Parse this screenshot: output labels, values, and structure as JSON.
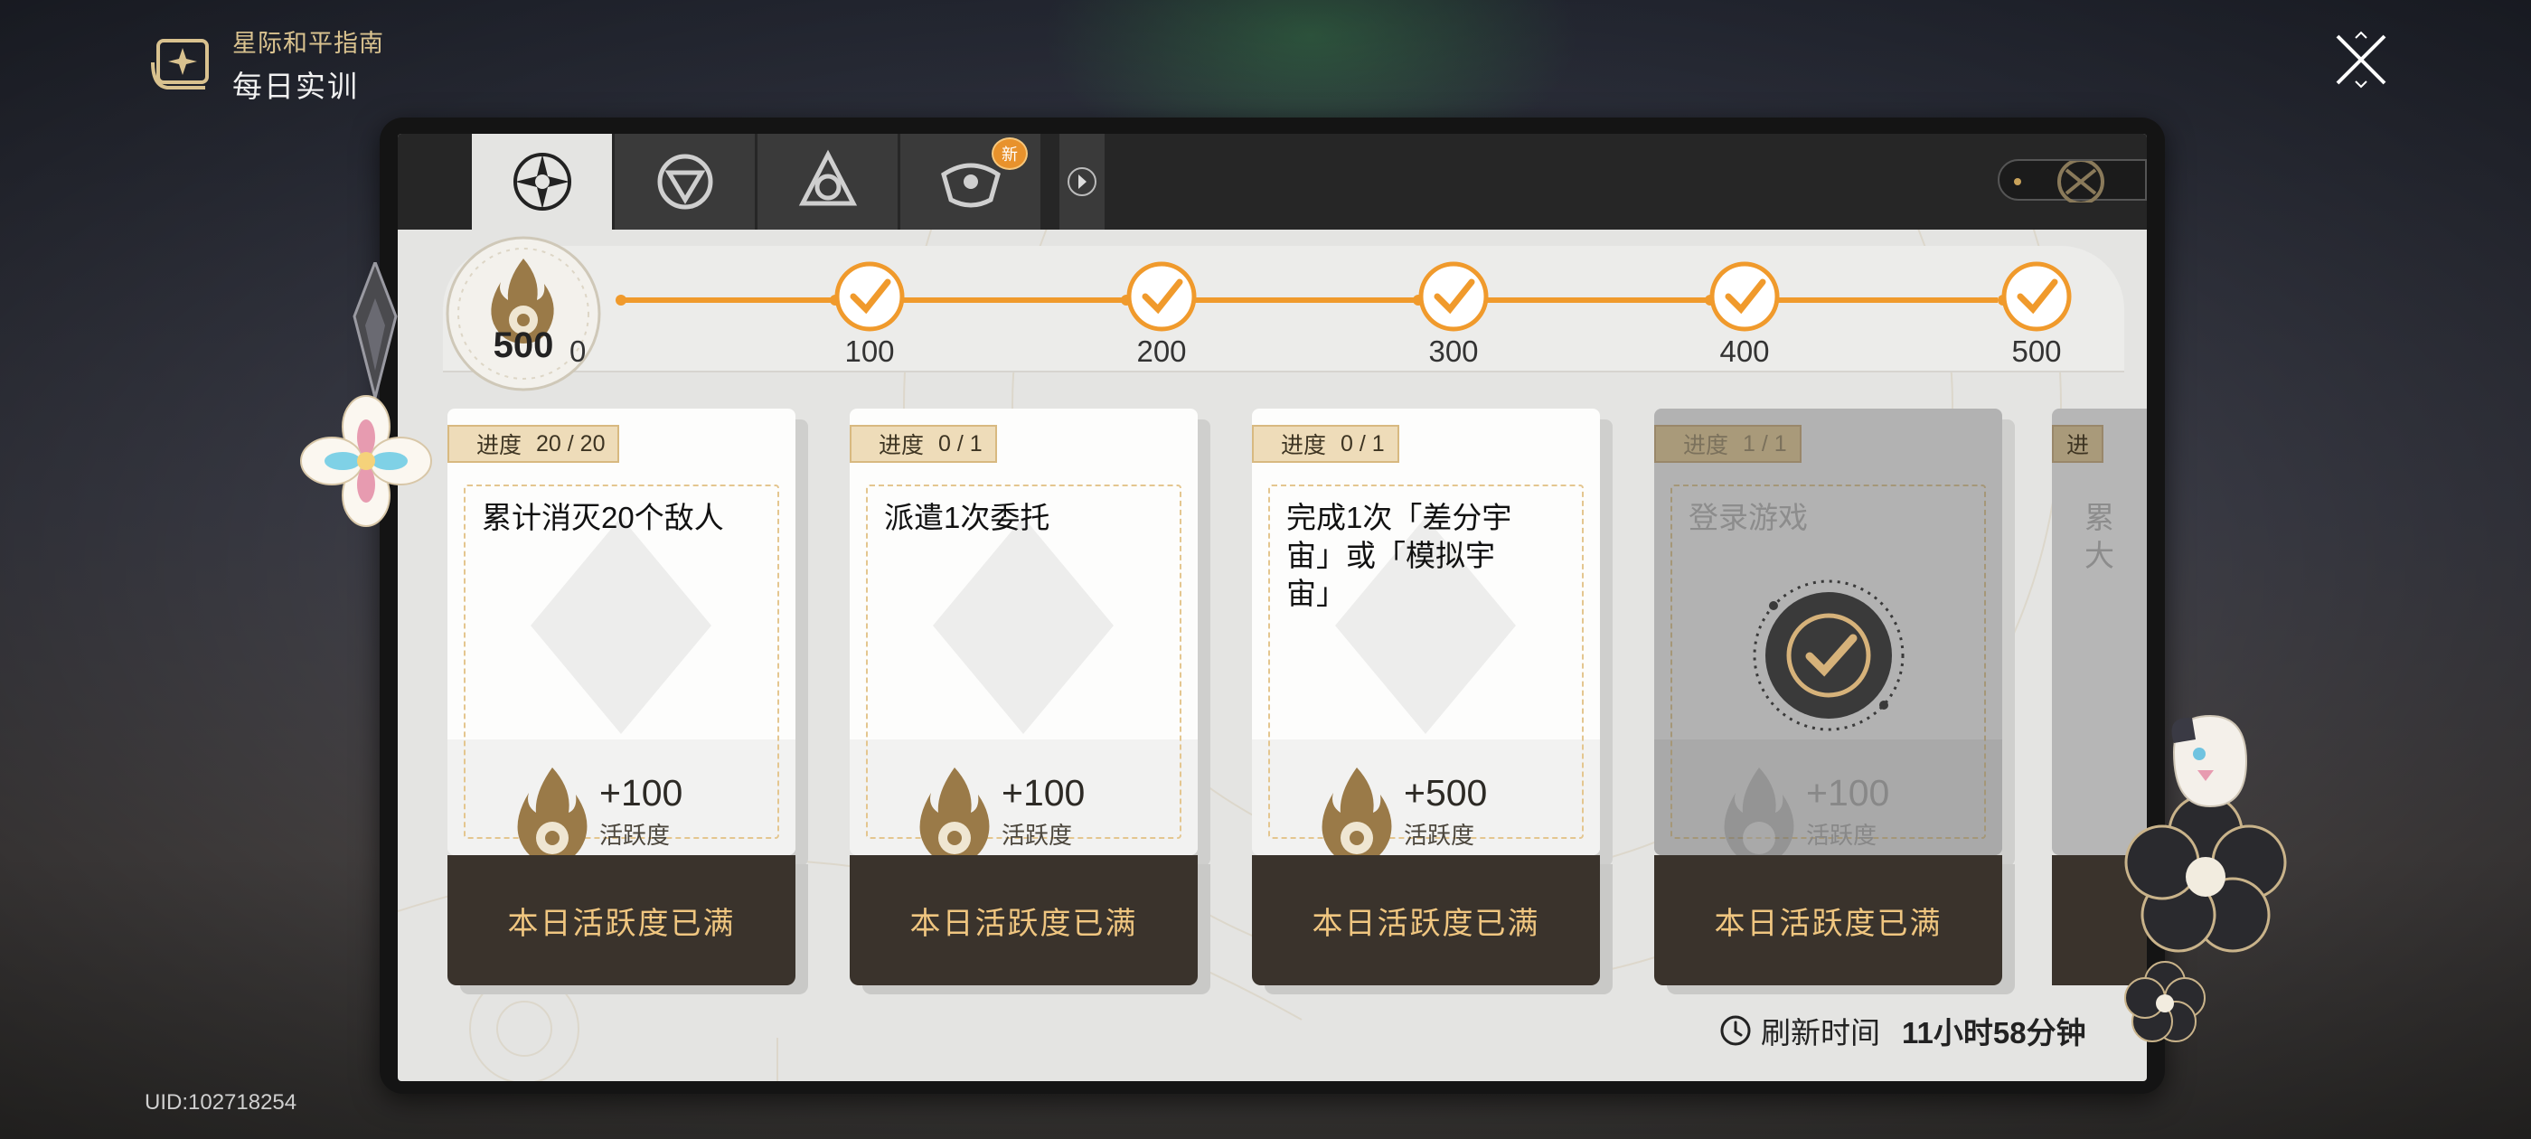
{
  "header": {
    "subtitle": "星际和平指南",
    "title": "每日实训",
    "icon": "guide-book-icon"
  },
  "close_icon": "close-icon",
  "uid": "UID:102718254",
  "tabs": [
    {
      "icon": "daily-training-icon",
      "active": true
    },
    {
      "icon": "survival-index-icon",
      "active": false
    },
    {
      "icon": "collection-icon",
      "active": false
    },
    {
      "icon": "treasure-icon",
      "active": false,
      "badge": "新"
    }
  ],
  "tab_arrow_icon": "chevron-right-icon",
  "activity": {
    "current": "500",
    "milestones": [
      "0",
      "100",
      "200",
      "300",
      "400",
      "500"
    ],
    "colors": {
      "accent": "#f09a2c",
      "button_text": "#f0c680",
      "button_bg": "#3a332c"
    }
  },
  "cards": [
    {
      "progress_label": "进度",
      "progress": "20 / 20",
      "description": "累计消灭20个敌人",
      "points": "+100",
      "unit": "活跃度",
      "button": "本日活跃度已满",
      "completed": false
    },
    {
      "progress_label": "进度",
      "progress": "0 / 1",
      "description": "派遣1次委托",
      "points": "+100",
      "unit": "活跃度",
      "button": "本日活跃度已满",
      "completed": false
    },
    {
      "progress_label": "进度",
      "progress": "0 / 1",
      "description": "完成1次「差分宇宙」或「模拟宇宙」",
      "points": "+500",
      "unit": "活跃度",
      "button": "本日活跃度已满",
      "completed": false
    },
    {
      "progress_label": "进度",
      "progress": "1 / 1",
      "description": "登录游戏",
      "points": "+100",
      "unit": "活跃度",
      "button": "本日活跃度已满",
      "completed": true
    }
  ],
  "partial_card": {
    "progress_label": "进",
    "description": "累\n大"
  },
  "refresh": {
    "label": "刷新时间",
    "time": "11小时58分钟",
    "icon": "clock-icon"
  }
}
